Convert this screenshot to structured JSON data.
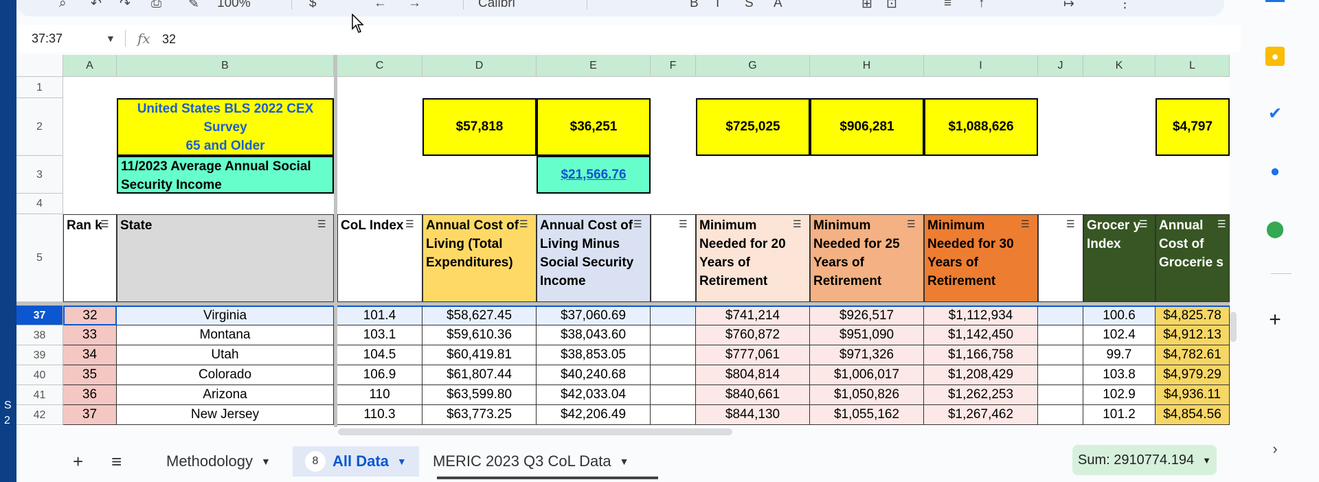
{
  "formula_bar": {
    "name_box": "37:37",
    "fx_label": "fx",
    "value": "32"
  },
  "toolbar": {
    "zoom": "100%",
    "font": "Calibri"
  },
  "columns": [
    "A",
    "B",
    "C",
    "D",
    "E",
    "F",
    "G",
    "H",
    "I",
    "J",
    "K",
    "L"
  ],
  "rows_top": [
    "1",
    "2",
    "3",
    "4",
    "5"
  ],
  "title_cell": "United States BLS 2022 CEX Survey\n65 and Older",
  "ss_label": "11/2023 Average Annual Social Security Income",
  "row2": {
    "d": "$57,818",
    "e": "$36,251",
    "g": "$725,025",
    "h": "$906,281",
    "i": "$1,088,626",
    "l": "$4,797"
  },
  "row3": {
    "e": "$21,566.76"
  },
  "headers": {
    "a": "Ran k",
    "b": "State",
    "c": "CoL Index",
    "d": "Annual Cost of Living (Total Expenditures)",
    "e": "Annual Cost of Living Minus Social Security Income",
    "g": "Minimum Needed for 20 Years of Retirement",
    "h": "Minimum Needed for 25 Years of Retirement",
    "i": "Minimum Needed for 30 Years of Retirement",
    "k": "Grocer y Index",
    "l": "Annual Cost of Grocerie s"
  },
  "data_rows": [
    {
      "row": "37",
      "rank": "32",
      "state": "Virginia",
      "col": "101.4",
      "cost": "$58,627.45",
      "minus": "$37,060.69",
      "y20": "$741,214",
      "y25": "$926,517",
      "y30": "$1,112,934",
      "groc": "100.6",
      "grocost": "$4,825.78"
    },
    {
      "row": "38",
      "rank": "33",
      "state": "Montana",
      "col": "103.1",
      "cost": "$59,610.36",
      "minus": "$38,043.60",
      "y20": "$760,872",
      "y25": "$951,090",
      "y30": "$1,142,450",
      "groc": "102.4",
      "grocost": "$4,912.13"
    },
    {
      "row": "39",
      "rank": "34",
      "state": "Utah",
      "col": "104.5",
      "cost": "$60,419.81",
      "minus": "$38,853.05",
      "y20": "$777,061",
      "y25": "$971,326",
      "y30": "$1,166,758",
      "groc": "99.7",
      "grocost": "$4,782.61"
    },
    {
      "row": "40",
      "rank": "35",
      "state": "Colorado",
      "col": "106.9",
      "cost": "$61,807.44",
      "minus": "$40,240.68",
      "y20": "$804,814",
      "y25": "$1,006,017",
      "y30": "$1,208,429",
      "groc": "103.8",
      "grocost": "$4,979.29"
    },
    {
      "row": "41",
      "rank": "36",
      "state": "Arizona",
      "col": "110",
      "cost": "$63,599.80",
      "minus": "$42,033.04",
      "y20": "$840,661",
      "y25": "$1,050,826",
      "y30": "$1,262,253",
      "groc": "102.9",
      "grocost": "$4,936.11"
    },
    {
      "row": "42",
      "rank": "37",
      "state": "New Jersey",
      "col": "110.3",
      "cost": "$63,773.25",
      "minus": "$42,206.49",
      "y20": "$844,130",
      "y25": "$1,055,162",
      "y30": "$1,267,462",
      "groc": "101.2",
      "grocost": "$4,854.56"
    }
  ],
  "tabs": {
    "add": "+",
    "menu": "≡",
    "methodology": "Methodology",
    "all_data": "All Data",
    "all_data_badge": "8",
    "meric": "MERIC 2023 Q3 CoL Data"
  },
  "sum": "Sum: 2910774.194",
  "colors": {
    "header_green": "#c7ebd3",
    "select_blue": "#0b57d0"
  }
}
